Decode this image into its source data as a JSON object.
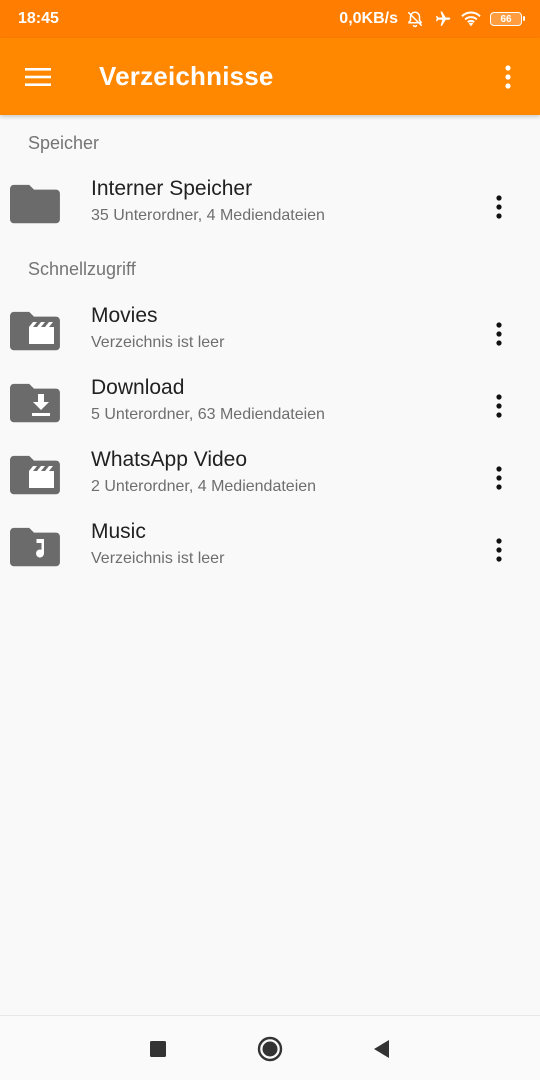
{
  "status_bar": {
    "time": "18:45",
    "net_speed": "0,0KB/s",
    "battery": "66",
    "icons": [
      "notifications-off-icon",
      "airplane-icon",
      "wifi-icon",
      "battery-icon"
    ]
  },
  "app_bar": {
    "title": "Verzeichnisse",
    "background": "#ff8800",
    "icons": [
      "menu-icon",
      "more-vert-icon"
    ]
  },
  "sections": [
    {
      "header": "Speicher",
      "items": [
        {
          "title": "Interner Speicher",
          "subtitle": "35 Unterordner, 4 Mediendateien",
          "icon": "folder-icon"
        }
      ]
    },
    {
      "header": "Schnellzugriff",
      "items": [
        {
          "title": "Movies",
          "subtitle": "Verzeichnis ist leer",
          "icon": "folder-video-icon"
        },
        {
          "title": "Download",
          "subtitle": "5 Unterordner, 63 Mediendateien",
          "icon": "folder-download-icon"
        },
        {
          "title": "WhatsApp Video",
          "subtitle": "2 Unterordner, 4 Mediendateien",
          "icon": "folder-video-icon"
        },
        {
          "title": "Music",
          "subtitle": "Verzeichnis ist leer",
          "icon": "folder-music-icon"
        }
      ]
    }
  ],
  "nav_bar": {
    "icons": [
      "recents-square-icon",
      "home-circle-icon",
      "back-triangle-icon"
    ]
  },
  "colors": {
    "accent": "#ff8800",
    "status_bar": "#ff7d00",
    "folder_icon": "#6b6b6b"
  }
}
